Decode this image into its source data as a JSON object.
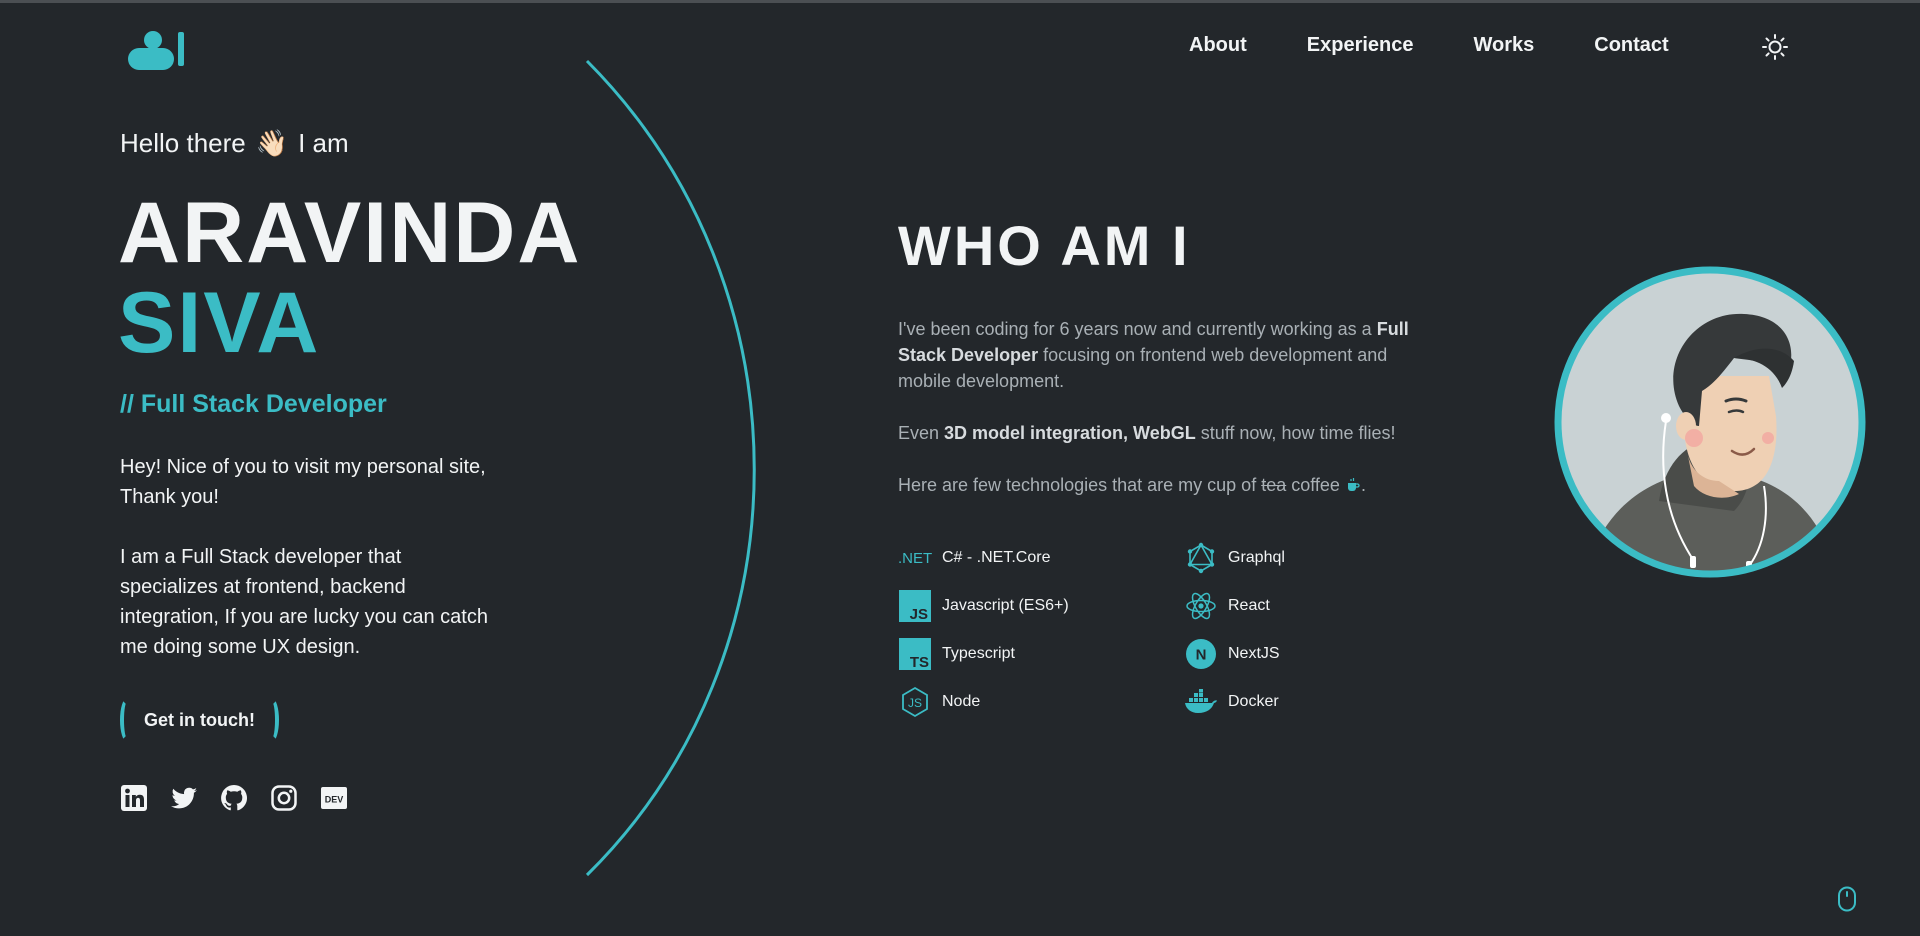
{
  "header": {
    "nav": [
      "About",
      "Experience",
      "Works",
      "Contact"
    ]
  },
  "hero": {
    "greeting_before": "Hello there",
    "wave_emoji": "👋🏻",
    "greeting_after": "I am",
    "first_name": "ARAVINDA",
    "last_name": "SIVA",
    "role": "// Full Stack Developer",
    "intro_1": "Hey! Nice of you to visit my personal site, Thank you!",
    "intro_2": "I am a Full Stack developer that specializes at frontend, backend integration, If you are lucky you can catch me doing some UX design.",
    "cta": "Get in touch!"
  },
  "socials": [
    "linkedin-icon",
    "twitter-icon",
    "github-icon",
    "instagram-icon",
    "dev-icon"
  ],
  "about": {
    "title": "WHO AM I",
    "p1_a": "I've been coding for 6 years now and currently working as a ",
    "p1_b": "Full Stack Developer",
    "p1_c": " focusing on frontend web development and mobile development.",
    "p2_a": "Even ",
    "p2_b": "3D model integration, WebGL",
    "p2_c": " stuff now, how time flies!",
    "p3_a": "Here are few technologies that are my cup of ",
    "p3_strike": "tea",
    "p3_b": " coffee ",
    "p3_end": "."
  },
  "technologies": [
    {
      "label": "C# - .NET.Core",
      "icon": "dotnet-icon"
    },
    {
      "label": "Graphql",
      "icon": "graphql-icon"
    },
    {
      "label": "Javascript (ES6+)",
      "icon": "javascript-icon"
    },
    {
      "label": "React",
      "icon": "react-icon"
    },
    {
      "label": "Typescript",
      "icon": "typescript-icon"
    },
    {
      "label": "NextJS",
      "icon": "nextjs-icon"
    },
    {
      "label": "Node",
      "icon": "node-icon"
    },
    {
      "label": "Docker",
      "icon": "docker-icon"
    }
  ],
  "colors": {
    "background": "#23272b",
    "accent": "#3bbcc5",
    "text": "#f2f4f5",
    "muted": "#a9b0b5"
  }
}
